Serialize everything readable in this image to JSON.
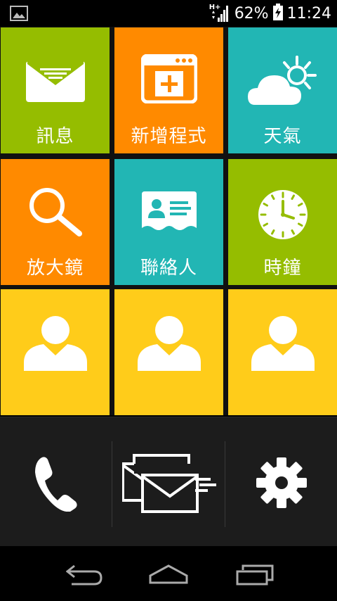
{
  "status": {
    "network": "H+",
    "battery": "62%",
    "time": "11:24"
  },
  "tiles": [
    {
      "label": "訊息",
      "icon": "envelope-icon",
      "color": "#95bd00"
    },
    {
      "label": "新增程式",
      "icon": "add-app-icon",
      "color": "#ff8a00"
    },
    {
      "label": "天氣",
      "icon": "weather-icon",
      "color": "#22b6b4"
    },
    {
      "label": "放大鏡",
      "icon": "magnifier-icon",
      "color": "#ff8a00"
    },
    {
      "label": "聯絡人",
      "icon": "contact-card-icon",
      "color": "#22b6b4"
    },
    {
      "label": "時鐘",
      "icon": "clock-icon",
      "color": "#95bd00"
    },
    {
      "label": "",
      "icon": "person-icon",
      "color": "#ffcc1a"
    },
    {
      "label": "",
      "icon": "person-icon",
      "color": "#ffcc1a"
    },
    {
      "label": "",
      "icon": "person-icon",
      "color": "#ffcc1a"
    }
  ],
  "dock": [
    {
      "icon": "phone-icon"
    },
    {
      "icon": "messages-icon"
    },
    {
      "icon": "settings-gear-icon"
    }
  ],
  "nav": [
    {
      "icon": "back-icon"
    },
    {
      "icon": "home-icon"
    },
    {
      "icon": "recent-apps-icon"
    }
  ]
}
